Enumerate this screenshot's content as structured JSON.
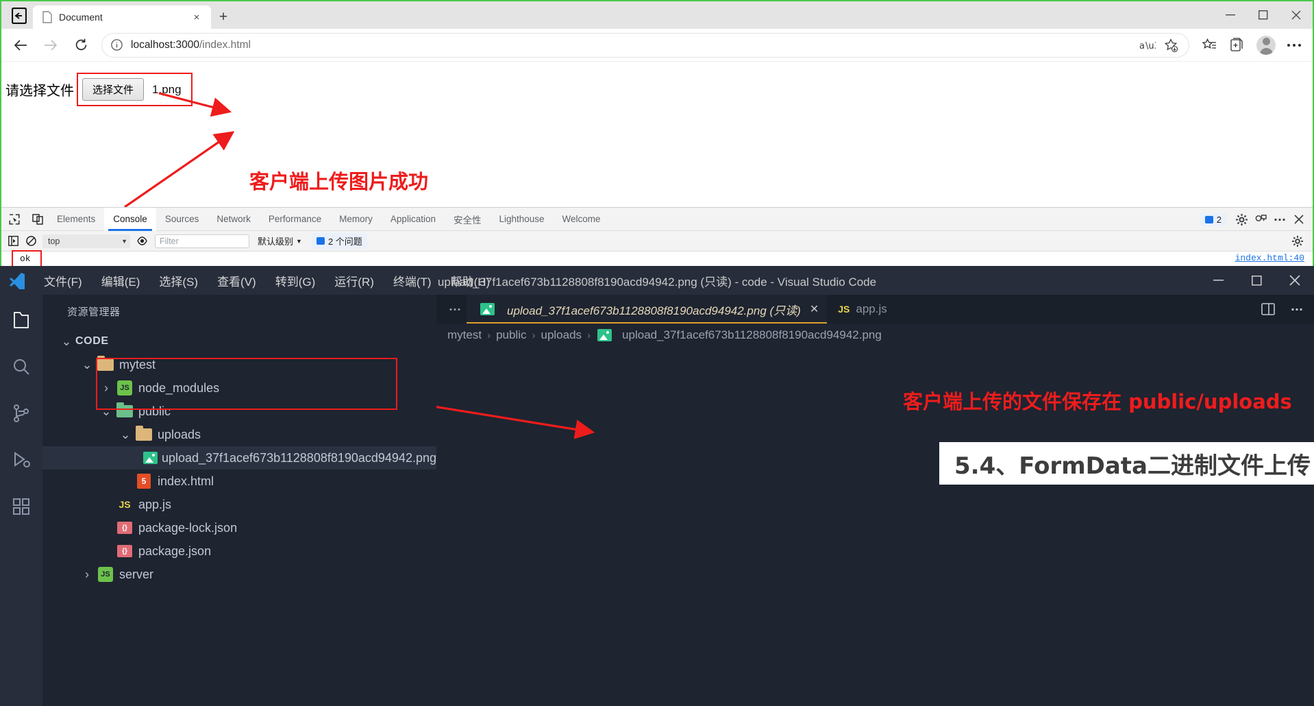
{
  "browser": {
    "tab": {
      "title": "Document",
      "close_label": "×"
    },
    "newtab_label": "+",
    "window_controls": {
      "minimize": "–",
      "maximize": "❑",
      "close": "✕"
    },
    "address": {
      "url_host": "localhost:3000",
      "url_path": "/index.html",
      "full_url": "localhost:3000/index.html"
    },
    "page": {
      "prompt_label": "请选择文件",
      "choose_button": "选择文件",
      "file_name": "1.png",
      "annotation": "客户端上传图片成功"
    },
    "devtools": {
      "tabs": [
        {
          "label": "Elements",
          "active": false
        },
        {
          "label": "Console",
          "active": true
        },
        {
          "label": "Sources",
          "active": false
        },
        {
          "label": "Network",
          "active": false
        },
        {
          "label": "Performance",
          "active": false
        },
        {
          "label": "Memory",
          "active": false
        },
        {
          "label": "Application",
          "active": false
        },
        {
          "label": "安全性",
          "active": false
        },
        {
          "label": "Lighthouse",
          "active": false
        },
        {
          "label": "Welcome",
          "active": false
        }
      ],
      "issues_count": "2",
      "filter": {
        "context": "top",
        "placeholder": "Filter",
        "level": "默认级别",
        "issues_label": "2 个问题"
      },
      "console_output": "ok",
      "source_link": "index.html:40"
    }
  },
  "vscode": {
    "menus": [
      "文件(F)",
      "编辑(E)",
      "选择(S)",
      "查看(V)",
      "转到(G)",
      "运行(R)",
      "终端(T)",
      "帮助(H)"
    ],
    "title": "upload_37f1acef673b1128808f8190acd94942.png (只读) - code - Visual Studio Code",
    "window_controls": {
      "minimize": "─",
      "maximize": "❐",
      "close": "✕"
    },
    "explorer": {
      "title": "资源管理器",
      "more_label": "⋯",
      "root": "CODE",
      "tree": [
        {
          "label": "mytest",
          "indent": 1,
          "icon": "folder",
          "chevron": "⌄",
          "selected": false
        },
        {
          "label": "node_modules",
          "indent": 2,
          "icon": "node",
          "chevron": "›",
          "selected": false
        },
        {
          "label": "public",
          "indent": 2,
          "icon": "folder-green",
          "chevron": "⌄",
          "selected": false
        },
        {
          "label": "uploads",
          "indent": 3,
          "icon": "folder",
          "chevron": "⌄",
          "selected": false
        },
        {
          "label": "upload_37f1acef673b1128808f8190acd94942.png",
          "indent": 4,
          "icon": "image",
          "chevron": "",
          "selected": true
        },
        {
          "label": "index.html",
          "indent": 3,
          "icon": "html5",
          "chevron": "",
          "selected": false
        },
        {
          "label": "app.js",
          "indent": 2,
          "icon": "js",
          "chevron": "",
          "selected": false
        },
        {
          "label": "package-lock.json",
          "indent": 2,
          "icon": "json",
          "chevron": "",
          "selected": false
        },
        {
          "label": "package.json",
          "indent": 2,
          "icon": "json",
          "chevron": "",
          "selected": false
        },
        {
          "label": "server",
          "indent": 1,
          "icon": "node",
          "chevron": "›",
          "selected": false
        }
      ]
    },
    "editor": {
      "tabs": [
        {
          "label": "upload_37f1acef673b1128808f8190acd94942.png (只读)",
          "icon": "image",
          "active": true,
          "close": "✕"
        },
        {
          "label": "app.js",
          "icon": "js",
          "active": false,
          "badge": "JS"
        }
      ],
      "breadcrumbs": [
        "mytest",
        "public",
        "uploads",
        "upload_37f1acef673b1128808f8190acd94942.png"
      ],
      "breadcrumb_sep": "›",
      "annotation": "客户端上传的文件保存在 public/uploads",
      "title_card": "5.4、FormData二进制文件上传"
    }
  },
  "colors": {
    "accent_red": "#ee1c1c",
    "vscode_bg": "#1e2430",
    "vscode_titlebar": "#272d3b",
    "devtools_accent": "#1a73e8",
    "window_border_green": "#4bc94b"
  }
}
